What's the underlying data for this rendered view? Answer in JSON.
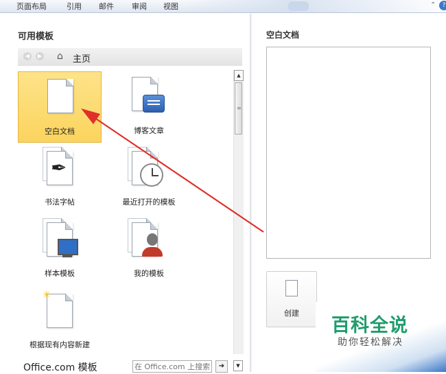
{
  "ribbon": {
    "tabs": [
      "页面布局",
      "引用",
      "邮件",
      "审阅",
      "视图"
    ],
    "caret": "⌃",
    "help": "?"
  },
  "left": {
    "title": "可用模板",
    "nav": {
      "back": "◀",
      "forward": "▶",
      "home_label": "主页"
    },
    "templates": [
      {
        "label": "空白文档",
        "icon": "blank-document-icon",
        "selected": true
      },
      {
        "label": "博客文章",
        "icon": "blog-post-icon"
      },
      {
        "label": "书法字帖",
        "icon": "calligraphy-icon"
      },
      {
        "label": "最近打开的模板",
        "icon": "recent-templates-icon"
      },
      {
        "label": "样本模板",
        "icon": "sample-templates-icon"
      },
      {
        "label": "我的模板",
        "icon": "my-templates-icon"
      },
      {
        "label": "根据现有内容新建",
        "icon": "new-from-existing-icon"
      }
    ],
    "office_title": "Office.com 模板",
    "search_placeholder": "在 Office.com 上搜索"
  },
  "right": {
    "title": "空白文档",
    "create_label": "创建"
  },
  "watermark": {
    "main": "百科全说",
    "sub": "助你轻松解决"
  },
  "colors": {
    "selected_fill": "#fbd45e",
    "arrow": "#e0302a",
    "watermark": "#1f9d6c"
  }
}
